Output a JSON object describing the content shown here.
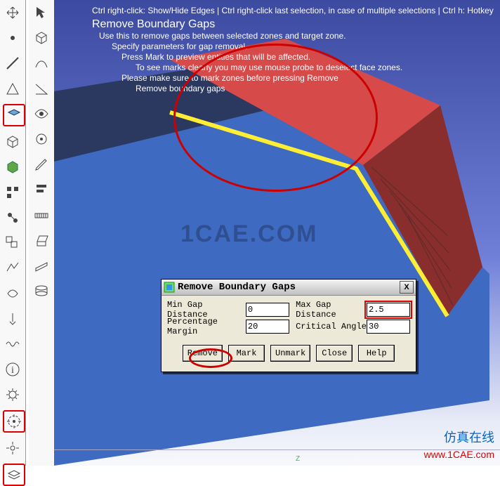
{
  "toolbars": {
    "left": [
      {
        "name": "move-tool",
        "svg": "move"
      },
      {
        "name": "point-tool",
        "svg": "dot"
      },
      {
        "name": "line-tool",
        "svg": "line"
      },
      {
        "name": "triangle-tool",
        "svg": "tri"
      },
      {
        "name": "face-tool",
        "svg": "face",
        "boxed": true
      },
      {
        "name": "box-tool",
        "svg": "box"
      },
      {
        "name": "volume-tool",
        "svg": "vol"
      },
      {
        "name": "selection-tool",
        "svg": "sel"
      },
      {
        "name": "link-tool",
        "svg": "link"
      },
      {
        "name": "group-tool",
        "svg": "group"
      },
      {
        "name": "snap-tool",
        "svg": "snap"
      },
      {
        "name": "wrap-tool",
        "svg": "wrap"
      },
      {
        "name": "probe-tool",
        "svg": "probe"
      },
      {
        "name": "wave-tool",
        "svg": "wave"
      },
      {
        "name": "info-tool",
        "svg": "info"
      },
      {
        "name": "gear-tool",
        "svg": "gear"
      },
      {
        "name": "target-tool",
        "svg": "target",
        "boxed": true
      },
      {
        "name": "expand-tool",
        "svg": "expand"
      },
      {
        "name": "layers-tool",
        "svg": "layers",
        "boxed": true
      }
    ],
    "right": [
      {
        "name": "cursor-tool",
        "svg": "arrow"
      },
      {
        "name": "primitive-tool",
        "svg": "box"
      },
      {
        "name": "sketch-tool",
        "svg": "sketch"
      },
      {
        "name": "angle-tool",
        "svg": "angle"
      },
      {
        "name": "eye-tool",
        "svg": "eye"
      },
      {
        "name": "focus-tool",
        "svg": "focus"
      },
      {
        "name": "pencil-tool",
        "svg": "pencil"
      },
      {
        "name": "align-tool",
        "svg": "align"
      },
      {
        "name": "measure-tool",
        "svg": "measure"
      },
      {
        "name": "extrude-tool",
        "svg": "extrude"
      },
      {
        "name": "planar-tool",
        "svg": "planar"
      },
      {
        "name": "loft-tool",
        "svg": "loft"
      }
    ]
  },
  "hints": {
    "line0": "Ctrl right-click: Show/Hide Edges | Ctrl right-click last selection, in case of multiple selections | Ctrl h: Hotkey",
    "title": "Remove Boundary Gaps",
    "line2": "Use this to remove gaps between selected zones and target zone.",
    "line3": "Specify parameters for gap removal.",
    "line4": "Press Mark to preview entities that will be affected.",
    "line5": "To see marks clearly you may use mouse probe to deselect face zones.",
    "line6": "Please make sure to mark zones before pressing Remove",
    "line7": "Remove boundary gaps"
  },
  "dialog": {
    "title": "Remove Boundary Gaps",
    "labels": {
      "min_gap": "Min Gap Distance",
      "max_gap": "Max Gap Distance",
      "percentage_margin": "Percentage Margin",
      "critical_angle": "Critical Angle"
    },
    "values": {
      "min_gap": "0",
      "max_gap": "2.5",
      "percentage_margin": "20",
      "critical_angle": "30"
    },
    "buttons": {
      "remove": "Remove",
      "mark": "Mark",
      "unmark": "Unmark",
      "close": "Close",
      "help": "Help"
    },
    "close_x": "X"
  },
  "watermarks": {
    "main": "1CAE.COM",
    "cn": "仿真在线",
    "url": "www.1CAE.com"
  },
  "axis": {
    "z": "Z"
  }
}
